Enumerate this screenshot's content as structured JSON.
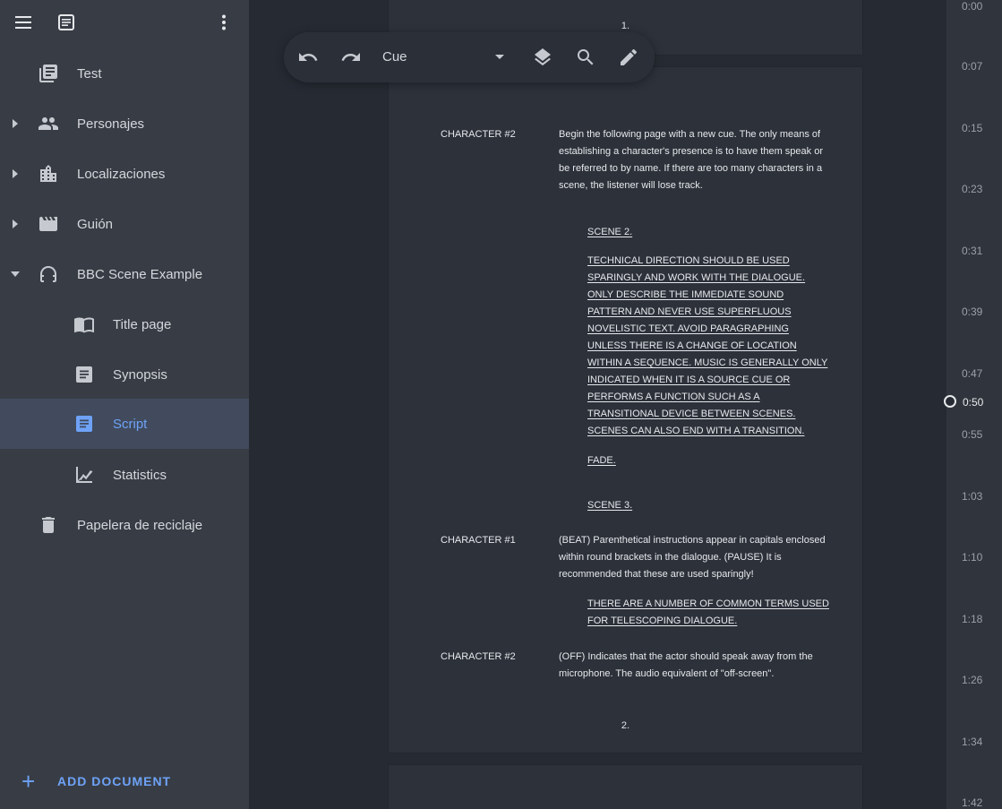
{
  "sidebar": {
    "items": [
      {
        "label": "Test"
      },
      {
        "label": "Personajes"
      },
      {
        "label": "Localizaciones"
      },
      {
        "label": "Guión"
      },
      {
        "label": "BBC Scene Example"
      },
      {
        "label": "Title page"
      },
      {
        "label": "Synopsis"
      },
      {
        "label": "Script"
      },
      {
        "label": "Statistics"
      },
      {
        "label": "Papelera de reciclaje"
      }
    ],
    "add_document_label": "ADD DOCUMENT",
    "active_item": "Script"
  },
  "toolbar": {
    "element_type": "Cue"
  },
  "script": {
    "page_top_number": "1.",
    "page_main_number": "2.",
    "lines": [
      {
        "kind": "char",
        "text": "CHARACTER #2"
      },
      {
        "kind": "dialog",
        "text": "Begin the following page with a new cue. The only means of establishing a character's presence is to have them speak or be referred to by name. If there are too many characters in a scene, the listener will lose track."
      },
      {
        "kind": "sfx",
        "text": "SCENE 2."
      },
      {
        "kind": "sfx",
        "text": "TECHNICAL DIRECTION SHOULD BE USED SPARINGLY AND WORK WITH THE DIALOGUE. ONLY DESCRIBE THE IMMEDIATE SOUND PATTERN AND NEVER USE SUPERFLUOUS NOVELISTIC TEXT. AVOID PARAGRAPHING UNLESS THERE IS A CHANGE OF LOCATION WITHIN A SEQUENCE. MUSIC IS GENERALLY ONLY INDICATED WHEN IT IS A SOURCE CUE OR PERFORMS A FUNCTION SUCH AS A TRANSITIONAL DEVICE BETWEEN SCENES. SCENES CAN ALSO END WITH A TRANSITION."
      },
      {
        "kind": "sfx",
        "text": "FADE."
      },
      {
        "kind": "sfx",
        "text": "SCENE 3."
      },
      {
        "kind": "char",
        "text": "CHARACTER #1"
      },
      {
        "kind": "dialog",
        "text": "(BEAT) Parenthetical instructions appear in capitals enclosed within round brackets in the dialogue. (PAUSE) It is recommended that these are used sparingly!"
      },
      {
        "kind": "sfx",
        "text": "THERE ARE A NUMBER OF COMMON TERMS USED FOR TELESCOPING DIALOGUE."
      },
      {
        "kind": "char",
        "text": "CHARACTER #2"
      },
      {
        "kind": "dialog",
        "text": "(OFF) Indicates that the actor should speak away from the microphone. The audio equivalent of \"off-screen\"."
      }
    ]
  },
  "timeline": {
    "ticks": [
      "0:00",
      "0:07",
      "0:15",
      "0:23",
      "0:31",
      "0:39",
      "0:47",
      "0:55",
      "1:03",
      "1:10",
      "1:18",
      "1:26",
      "1:34",
      "1:42"
    ],
    "current": "0:50"
  },
  "colors": {
    "accent": "#6ea2f7",
    "sidebar_bg": "#383d45",
    "active_bg": "#414b5d",
    "editor_bg": "#262b33",
    "page_bg": "#2c313a"
  }
}
